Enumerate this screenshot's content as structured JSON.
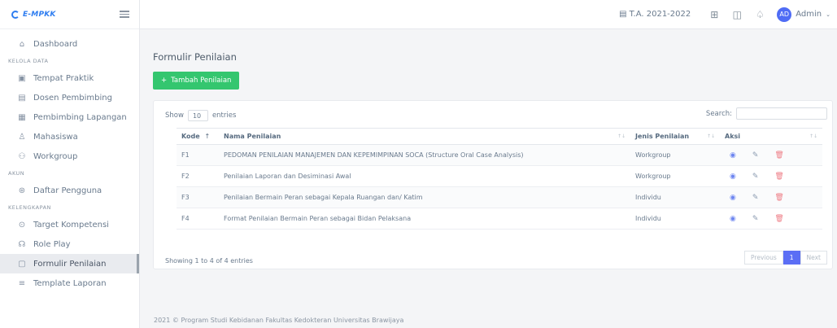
{
  "brand": {
    "name": "E-MPKK"
  },
  "sidebar": {
    "items": [
      {
        "label": "Dashboard",
        "icon": "home-icon",
        "glyph": "⌂"
      },
      {
        "section": "KELOLA DATA"
      },
      {
        "label": "Tempat Praktik",
        "icon": "building-icon",
        "glyph": "▣"
      },
      {
        "label": "Dosen Pembimbing",
        "icon": "id-card-icon",
        "glyph": "▤"
      },
      {
        "label": "Pembimbing Lapangan",
        "icon": "clipboard-icon",
        "glyph": "▦"
      },
      {
        "label": "Mahasiswa",
        "icon": "user-icon",
        "glyph": "♙"
      },
      {
        "label": "Workgroup",
        "icon": "group-icon",
        "glyph": "⚇"
      },
      {
        "section": "AKUN"
      },
      {
        "label": "Daftar Pengguna",
        "icon": "users-icon",
        "glyph": "⊛"
      },
      {
        "section": "KELENGKAPAN"
      },
      {
        "label": "Target Kompetensi",
        "icon": "target-icon",
        "glyph": "⊙"
      },
      {
        "label": "Role Play",
        "icon": "masks-icon",
        "glyph": "☊"
      },
      {
        "label": "Formulir Penilaian",
        "icon": "form-icon",
        "glyph": "▢",
        "active": true
      },
      {
        "label": "Template Laporan",
        "icon": "report-icon",
        "glyph": "≡"
      }
    ]
  },
  "topbar": {
    "academic_year": "T.A. 2021-2022",
    "user_initials": "AD",
    "user_name": "Admin"
  },
  "page": {
    "title": "Formulir Penilaian",
    "add_button": "Tambah Penilaian"
  },
  "table": {
    "show_label": "Show",
    "length_value": "10",
    "entries_label": "entries",
    "search_label": "Search:",
    "search_value": "",
    "headers": [
      "Kode",
      "Nama Penilaian",
      "Jenis Penilaian",
      "Aksi"
    ],
    "rows": [
      {
        "kode": "F1",
        "nama": "PEDOMAN PENILAIAN MANAJEMEN DAN KEPEMIMPINAN SOCA (Structure Oral Case Analysis)",
        "jenis": "Workgroup"
      },
      {
        "kode": "F2",
        "nama": "Penilaian Laporan dan Desiminasi Awal",
        "jenis": "Workgroup"
      },
      {
        "kode": "F3",
        "nama": "Penilaian Bermain Peran sebagai Kepala Ruangan dan/ Katim",
        "jenis": "Individu"
      },
      {
        "kode": "F4",
        "nama": "Format Penilaian Bermain Peran sebagai Bidan Pelaksana",
        "jenis": "Individu"
      }
    ],
    "info": "Showing 1 to 4 of 4 entries",
    "pager": {
      "previous": "Previous",
      "current": "1",
      "next": "Next"
    }
  },
  "footer": {
    "text": "2021 © Program Studi Kebidanan Fakultas Kedokteran Universitas Brawijaya"
  },
  "colors": {
    "accent": "#5b6ef5",
    "add_button": "#34c66f",
    "brand": "#2e7df0",
    "delete": "#ee7d86"
  }
}
